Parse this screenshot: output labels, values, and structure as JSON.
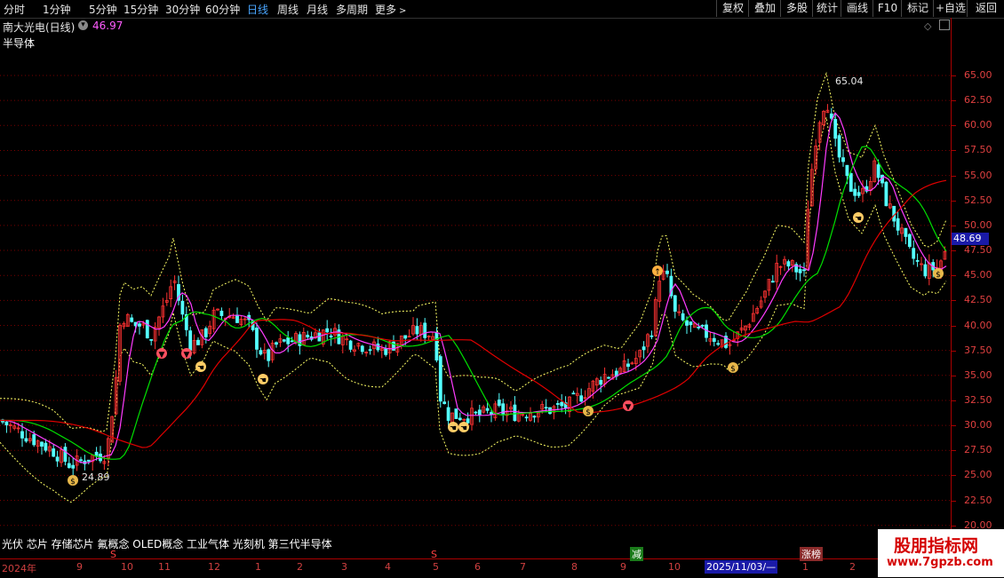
{
  "toolbar": {
    "periods": [
      "分时",
      "1分钟",
      "5分钟",
      "15分钟",
      "30分钟",
      "60分钟",
      "日线",
      "周线",
      "月线",
      "多周期",
      "更多"
    ],
    "active_period": "日线",
    "right_buttons": [
      "复权",
      "叠加",
      "多股",
      "统计",
      "画线",
      "F10",
      "标记",
      "+自选",
      "返回"
    ]
  },
  "title": {
    "stock": "南大光电(日线)",
    "value": "46.97",
    "indicator": "半导体"
  },
  "price_axis": {
    "ticks": [
      "65.00",
      "62.50",
      "60.00",
      "57.50",
      "55.00",
      "52.50",
      "50.00",
      "47.50",
      "45.00",
      "42.50",
      "40.00",
      "37.50",
      "35.00",
      "32.50",
      "30.00",
      "27.50",
      "25.00",
      "22.50",
      "20.00"
    ],
    "current_price": "48.69"
  },
  "annotations": {
    "high_label": "65.04",
    "low_label": "24.89"
  },
  "concepts": "光伏 芯片 存储芯片 氟概念 OLED概念 工业气体 光刻机 第三代半导体",
  "date_axis": {
    "labels": [
      "2024年",
      "9",
      "10",
      "11",
      "12",
      "1",
      "2",
      "3",
      "4",
      "5",
      "6",
      "7",
      "8",
      "9",
      "10",
      "1",
      "2"
    ],
    "cursor_date": "2025/11/03/—",
    "marker_s": "S",
    "marker_reduce": "减",
    "marker_board": "涨榜"
  },
  "watermark": {
    "title": "股朋指标网",
    "url": "www.7gpzb.com"
  },
  "colors": {
    "background": "#000000",
    "up": "#ff3232",
    "down": "#54ffff",
    "ma_fast": "#ff3cff",
    "ma_mid": "#00e000",
    "ma_slow": "#e00000",
    "band": "#ffff66"
  }
}
